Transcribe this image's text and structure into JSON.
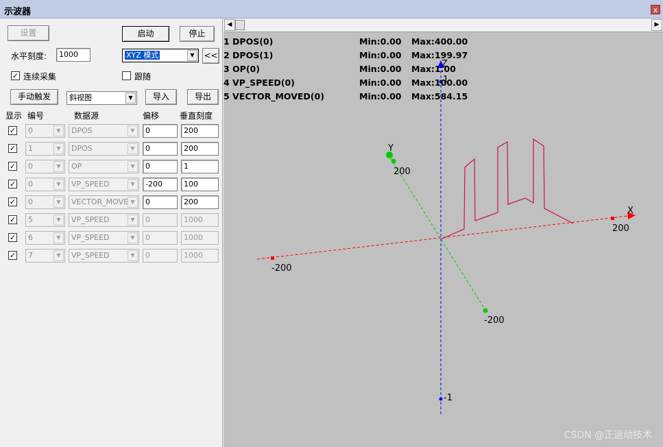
{
  "window": {
    "title": "示波器",
    "close": "x"
  },
  "toolbar": {
    "settings_label": "设置",
    "start_label": "启动",
    "stop_label": "停止",
    "h_scale_label": "水平刻度:",
    "h_scale_value": "1000",
    "mode_value": "XYZ 模式",
    "collapse_label": "<<",
    "continuous_label": "连续采集",
    "continuous_checked": true,
    "follow_label": "跟随",
    "follow_checked": false,
    "manual_trigger_label": "手动触发",
    "view_value": "斜视图",
    "import_label": "导入",
    "export_label": "导出"
  },
  "table": {
    "headers": [
      "显示",
      "编号",
      "数据源",
      "偏移",
      "垂直刻度"
    ],
    "rows": [
      {
        "show": true,
        "id": "0",
        "source": "DPOS",
        "offset": "0",
        "scale": "200",
        "enabled": true
      },
      {
        "show": true,
        "id": "1",
        "source": "DPOS",
        "offset": "0",
        "scale": "200",
        "enabled": true
      },
      {
        "show": true,
        "id": "0",
        "source": "OP",
        "offset": "0",
        "scale": "1",
        "enabled": true
      },
      {
        "show": true,
        "id": "0",
        "source": "VP_SPEED",
        "offset": "-200",
        "scale": "100",
        "enabled": true
      },
      {
        "show": true,
        "id": "0",
        "source": "VECTOR_MOVED",
        "offset": "0",
        "scale": "200",
        "enabled": true
      },
      {
        "show": true,
        "id": "5",
        "source": "VP_SPEED",
        "offset": "0",
        "scale": "1000",
        "enabled": false
      },
      {
        "show": true,
        "id": "6",
        "source": "VP_SPEED",
        "offset": "0",
        "scale": "1000",
        "enabled": false
      },
      {
        "show": true,
        "id": "7",
        "source": "VP_SPEED",
        "offset": "0",
        "scale": "1000",
        "enabled": false
      }
    ]
  },
  "legend": [
    {
      "name": "1 DPOS(0)",
      "min": "Min:0.00",
      "max": "Max:400.00"
    },
    {
      "name": "2 DPOS(1)",
      "min": "Min:0.00",
      "max": "Max:199.97"
    },
    {
      "name": "3 OP(0)",
      "min": "Min:0.00",
      "max": "Max:1.00"
    },
    {
      "name": "4 VP_SPEED(0)",
      "min": "Min:0.00",
      "max": "Max:100.00"
    },
    {
      "name": "5 VECTOR_MOVED(0)",
      "min": "Min:0.00",
      "max": "Max:584.15"
    }
  ],
  "plot": {
    "x_axis": {
      "name": "X",
      "pos_label": "200",
      "neg_label": "-200",
      "color": "#ff0000"
    },
    "y_axis": {
      "name": "Y",
      "pos_label": "200",
      "neg_label": "-200",
      "color": "#00cc00"
    },
    "z_axis": {
      "name": "Z",
      "pos_label": "1",
      "neg_label": "-1",
      "color": "#0000ff"
    },
    "trace_color": "#d0103a"
  },
  "watermark": "CSDN @正运动技术"
}
